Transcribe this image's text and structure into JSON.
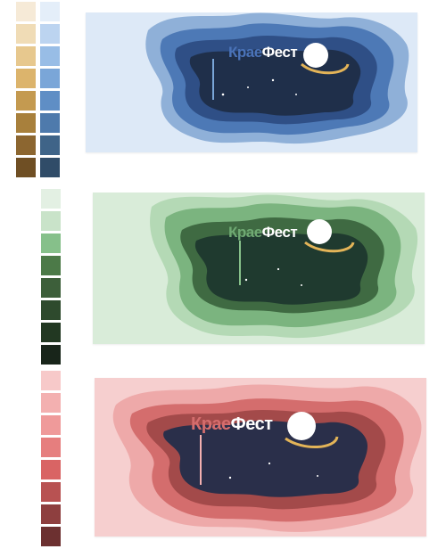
{
  "palettes": {
    "blue_warm": [
      "#f6ead7",
      "#f0dcb6",
      "#e7c88e",
      "#dcb46c",
      "#c49a50",
      "#a8803c",
      "#8c6630",
      "#6f4f24"
    ],
    "blue_cool": [
      "#e4eef9",
      "#bcd4f0",
      "#98bde6",
      "#7aa6d8",
      "#5f8ec5",
      "#4e7aac",
      "#3f6488",
      "#304c68"
    ],
    "green": [
      "#e3f0e3",
      "#c9e3c9",
      "#86c08a",
      "#4c7a48",
      "#3d5f3a",
      "#2e4a2d",
      "#223822",
      "#18251a"
    ],
    "red": [
      "#f7c9c9",
      "#f3b0b0",
      "#ef9a9a",
      "#e67e7e",
      "#d96464",
      "#b85252",
      "#8e3f3f",
      "#6c3030"
    ]
  },
  "cards": [
    {
      "brand_a": "Крае",
      "brand_b": "Фест",
      "bg": "#dde9f7",
      "layer1": "#8fb0d8",
      "layer2": "#4d79b6",
      "layer3": "#2f4f86",
      "sky": "#1f2f4a",
      "text_a": "#4a73b8",
      "text_b": "#ffffff"
    },
    {
      "brand_a": "Крае",
      "brand_b": "Фест",
      "bg": "#d9ecd9",
      "layer1": "#b4d9b5",
      "layer2": "#7bb47f",
      "layer3": "#3f6a42",
      "sky": "#1f3a2f",
      "text_a": "#6fa973",
      "text_b": "#ffffff"
    },
    {
      "brand_a": "Крае",
      "brand_b": "Фест",
      "bg": "#f6cfcf",
      "layer1": "#eea9a9",
      "layer2": "#d46d6d",
      "layer3": "#a34a4a",
      "sky": "#2a2f4a",
      "text_a": "#d46d6d",
      "text_b": "#ffffff"
    }
  ]
}
